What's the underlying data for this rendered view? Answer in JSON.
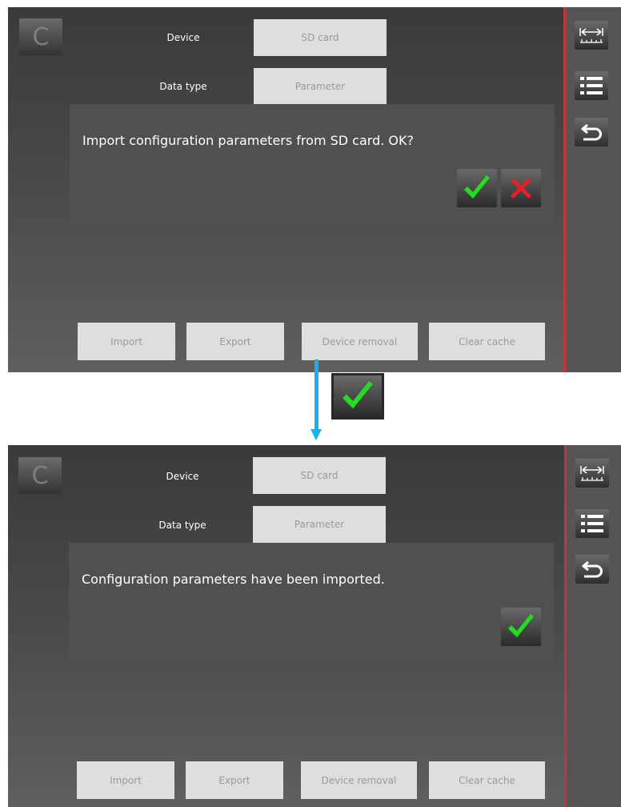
{
  "screens": [
    {
      "clear_button_label": "C",
      "device_label": "Device",
      "device_value": "SD card",
      "data_type_label": "Data type",
      "data_type_value": "Parameter",
      "dialog_message": "Import configuration parameters from SD card. OK?",
      "buttons": [
        "Import",
        "Export",
        "Device removal",
        "Clear cache"
      ]
    },
    {
      "clear_button_label": "C",
      "device_label": "Device",
      "device_value": "SD card",
      "data_type_label": "Data type",
      "data_type_value": "Parameter",
      "dialog_message": "Configuration parameters have been imported.",
      "buttons": [
        "Import",
        "Export",
        "Device removal",
        "Clear cache"
      ]
    }
  ],
  "sidebar_icons": [
    "measure-range-icon",
    "list-icon",
    "back-icon"
  ],
  "colors": {
    "accent_red_line": "#c8323a",
    "arrow_blue": "#1ab0ee",
    "confirm_green": "#22dd22",
    "cancel_red": "#ee1c24",
    "field_bg": "#dedede",
    "field_text": "#9a9a9a"
  }
}
